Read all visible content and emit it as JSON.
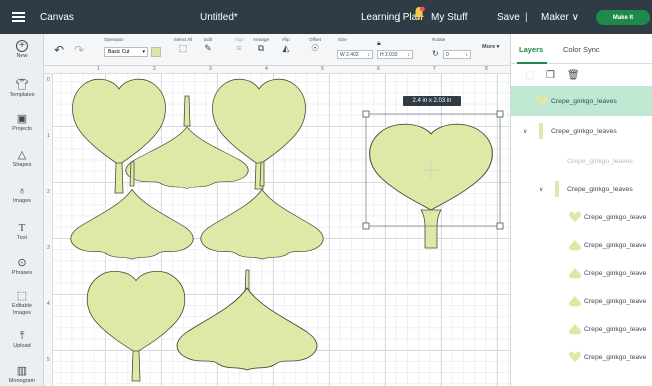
{
  "topbar": {
    "title": "Canvas",
    "document": "Untitled*",
    "plan": "Learning Plan",
    "separator": "|",
    "my_stuff": "My Stuff",
    "save": "Save",
    "machine": "Maker",
    "make_it": "Make It"
  },
  "sidebar": {
    "items": [
      {
        "label": "New",
        "icon": "plus-circle-icon"
      },
      {
        "label": "Templates",
        "icon": "shirt-icon"
      },
      {
        "label": "Projects",
        "icon": "clipboard-icon"
      },
      {
        "label": "Shapes",
        "icon": "shapes-icon"
      },
      {
        "label": "Images",
        "icon": "bulb-icon"
      },
      {
        "label": "Text",
        "icon": "text-icon"
      },
      {
        "label": "Phrases",
        "icon": "speech-bubble-icon"
      },
      {
        "label": "Editable Images",
        "icon": "editable-images-icon"
      },
      {
        "label": "Upload",
        "icon": "upload-icon"
      },
      {
        "label": "Monogram",
        "icon": "monogram-icon"
      }
    ]
  },
  "toolbar": {
    "operation_label": "Operation",
    "operation_value": "Basic Cut",
    "select_all": "Select All",
    "edit": "Edit",
    "align": "Align",
    "arrange": "Arrange",
    "flip": "Flip",
    "offset": "Offset",
    "size": "Size",
    "w_label": "W",
    "w_value": "2.402",
    "h_label": "H",
    "h_value": "2.033",
    "rotate": "Rotate",
    "rotate_value": "0",
    "more": "More"
  },
  "canvas": {
    "ruler_top": [
      "1",
      "2",
      "3",
      "4",
      "5",
      "6",
      "7",
      "8"
    ],
    "ruler_left": [
      "0",
      "1",
      "2",
      "3",
      "4",
      "5"
    ],
    "dimension_tag": "2.4  in x 2.03  in",
    "shape_color": "#dfe8a6",
    "shape_stroke": "#4b4b3a"
  },
  "panel": {
    "tabs": [
      "Layers",
      "Color Sync"
    ],
    "layers": [
      {
        "name": "Crepe_ginkgo_leaves",
        "state": "selected",
        "level": 0
      },
      {
        "name": "Crepe_ginkgo_leaves",
        "state": "group",
        "level": 0
      },
      {
        "name": "Crepe_ginkgo_leaves",
        "state": "faded",
        "level": 1
      },
      {
        "name": "Crepe_ginkgo_leaves",
        "state": "group",
        "level": 1
      },
      {
        "name": "Crepe_ginkgo_leave",
        "state": "normal",
        "level": 2
      },
      {
        "name": "Crepe_ginkgo_leave",
        "state": "normal",
        "level": 2
      },
      {
        "name": "Crepe_ginkgo_leave",
        "state": "normal",
        "level": 2
      },
      {
        "name": "Crepe_ginkgo_leave",
        "state": "normal",
        "level": 2
      },
      {
        "name": "Crepe_ginkgo_leave",
        "state": "normal",
        "level": 2
      },
      {
        "name": "Crepe_ginkgo_leave",
        "state": "normal",
        "level": 2
      }
    ]
  }
}
